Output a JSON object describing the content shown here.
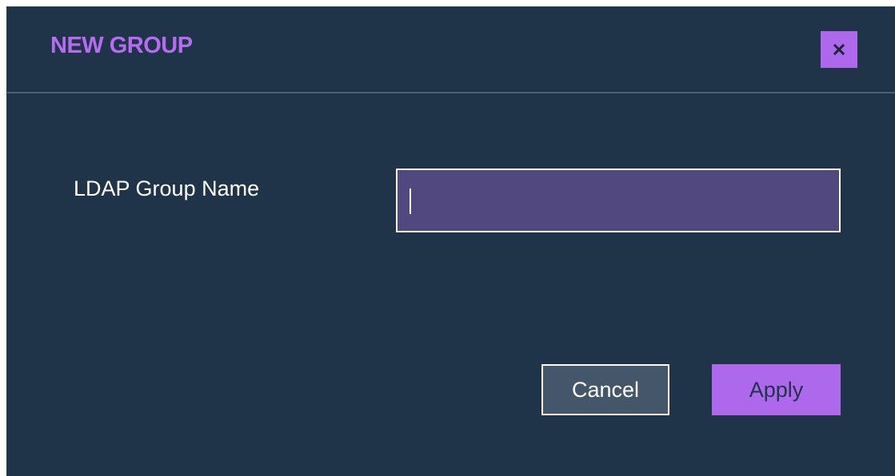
{
  "dialog": {
    "title": "NEW GROUP",
    "close_icon": "close-icon",
    "field": {
      "label": "LDAP Group Name",
      "value": "",
      "placeholder": ""
    },
    "buttons": {
      "cancel_label": "Cancel",
      "apply_label": "Apply"
    }
  },
  "colors": {
    "dialog_background": "#1f3349",
    "accent": "#ae68ec",
    "title": "#b56cf0",
    "input_background": "#524880",
    "cancel_background": "#44566a",
    "text": "#ffffff"
  }
}
